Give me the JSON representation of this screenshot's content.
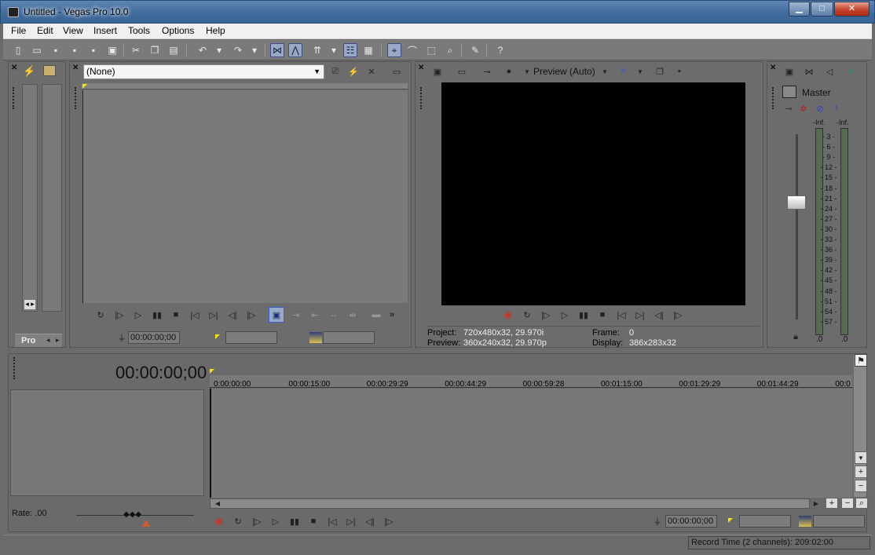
{
  "window": {
    "title": "Untitled - Vegas Pro 10.0",
    "minimize": "▁",
    "maximize": "□",
    "close": "✕"
  },
  "menu": [
    "File",
    "Edit",
    "View",
    "Insert",
    "Tools",
    "Options",
    "Help"
  ],
  "explorer": {
    "tab_label": "Pro",
    "scroll_arrow": "◂ ▸"
  },
  "trimmer": {
    "source_dropdown": "(None)",
    "timecode": "00:00:00;00"
  },
  "preview": {
    "quality": "Preview (Auto)",
    "project_label": "Project:",
    "project_value": "720x480x32, 29.970i",
    "preview_label": "Preview:",
    "preview_value": "360x240x32, 29.970p",
    "frame_label": "Frame:",
    "frame_value": "0",
    "display_label": "Display:",
    "display_value": "386x283x32"
  },
  "mixer": {
    "master_label": "Master",
    "left_peak": "-Inf.",
    "right_peak": "-Inf.",
    "scale": [
      "3",
      "6",
      "9",
      "12",
      "15",
      "18",
      "21",
      "24",
      "27",
      "30",
      "33",
      "36",
      "39",
      "42",
      "45",
      "48",
      "51",
      "54",
      "57"
    ],
    "left_value": ".0",
    "right_value": ".0",
    "colors": {
      "meter_bg": "#566b52"
    }
  },
  "timeline": {
    "cursor_time": "00:00:00;00",
    "ruler": [
      "0:00:00:00",
      "00:00:15:00",
      "00:00:29:29",
      "00:00:44:29",
      "00:00:59:28",
      "00:01:15:00",
      "00:01:29:29",
      "00:01:44:29",
      "00:0"
    ],
    "rate_label": "Rate: .00",
    "transport_timecode": "00:00:00;00",
    "record_time": "Record Time (2 channels): 209:02:00"
  },
  "accent": {
    "record_red": "#c0392b",
    "selected_blue": "#3c5cc8",
    "marker_yellow": "#f5e400"
  }
}
